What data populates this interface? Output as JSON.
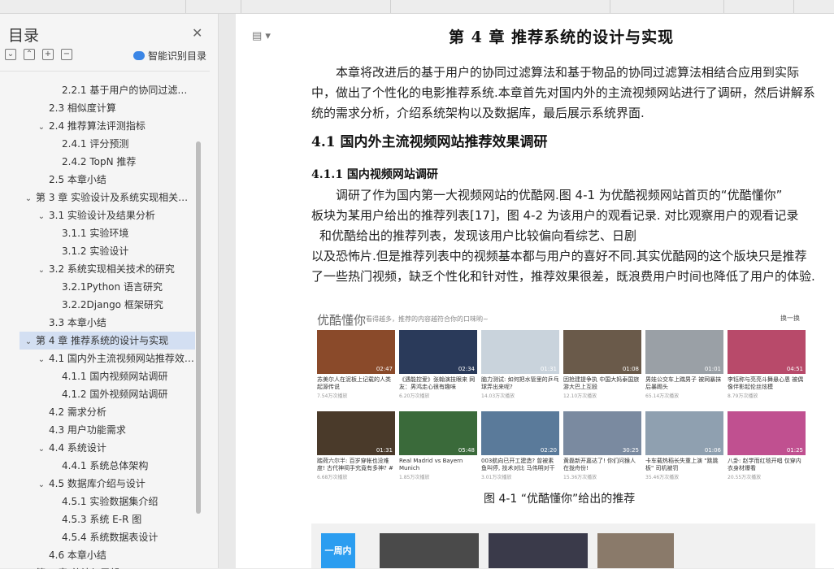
{
  "sidebar": {
    "title": "目录",
    "smart_label": "智能识别目录",
    "items": [
      {
        "label": "2.2.1 基于用户的协同过滤算法",
        "level": 3,
        "arrow": ""
      },
      {
        "label": "2.3 相似度计算",
        "level": 2,
        "arrow": ""
      },
      {
        "label": "2.4 推荐算法评测指标",
        "level": 2,
        "arrow": "⌄"
      },
      {
        "label": "2.4.1 评分预测",
        "level": 3,
        "arrow": ""
      },
      {
        "label": "2.4.2 TopN 推荐",
        "level": 3,
        "arrow": ""
      },
      {
        "label": "2.5 本章小结",
        "level": 2,
        "arrow": ""
      },
      {
        "label": "第 3 章 实验设计及系统实现相关技术",
        "level": 1,
        "arrow": "⌄"
      },
      {
        "label": "3.1 实验设计及结果分析",
        "level": 2,
        "arrow": "⌄"
      },
      {
        "label": "3.1.1 实验环境",
        "level": 3,
        "arrow": ""
      },
      {
        "label": "3.1.2 实验设计",
        "level": 3,
        "arrow": ""
      },
      {
        "label": "3.2 系统实现相关技术的研究",
        "level": 2,
        "arrow": "⌄"
      },
      {
        "label": "3.2.1Python 语言研究",
        "level": 3,
        "arrow": ""
      },
      {
        "label": "3.2.2Django 框架研究",
        "level": 3,
        "arrow": ""
      },
      {
        "label": "3.3 本章小结",
        "level": 2,
        "arrow": ""
      },
      {
        "label": "第 4 章 推荐系统的设计与实现",
        "level": 1,
        "arrow": "⌄",
        "selected": true
      },
      {
        "label": "4.1 国内外主流视频网站推荐效果调研",
        "level": 2,
        "arrow": "⌄"
      },
      {
        "label": "4.1.1 国内视频网站调研",
        "level": 3,
        "arrow": ""
      },
      {
        "label": "4.1.2 国外视频网站调研",
        "level": 3,
        "arrow": ""
      },
      {
        "label": "4.2 需求分析",
        "level": 2,
        "arrow": ""
      },
      {
        "label": "4.3 用户功能需求",
        "level": 2,
        "arrow": ""
      },
      {
        "label": "4.4 系统设计",
        "level": 2,
        "arrow": "⌄"
      },
      {
        "label": "4.4.1 系统总体架构",
        "level": 3,
        "arrow": ""
      },
      {
        "label": "4.5 数据库介绍与设计",
        "level": 2,
        "arrow": "⌄"
      },
      {
        "label": "4.5.1 实验数据集介绍",
        "level": 3,
        "arrow": ""
      },
      {
        "label": "4.5.3 系统 E-R 图",
        "level": 3,
        "arrow": ""
      },
      {
        "label": "4.5.4 系统数据表设计",
        "level": 3,
        "arrow": ""
      },
      {
        "label": "4.6 本章小结",
        "level": 2,
        "arrow": ""
      },
      {
        "label": "第 5 章 总结与展望",
        "level": 1,
        "arrow": "⌄"
      }
    ]
  },
  "doc": {
    "chapter_title": "第 4 章 推荐系统的设计与实现",
    "intro": "本章将改进后的基于用户的协同过滤算法和基于物品的协同过滤算法相结合应用到实际中，做出了个性化的电影推荐系统.本章首先对国内外的主流视频网站进行了调研，然后讲解系统的需求分析，介绍系统架构以及数据库，最后展示系统界面.",
    "h2": "4.1  国内外主流视频网站推荐效果调研",
    "h3": "4.1.1  国内视频网站调研",
    "body_line1": "调研了作为国内第一大视频网站的优酷网.图 4-1 为优酷视频网站首页的“优酷懂你”",
    "body_line2": "板块为某用户给出的推荐列表[17]，图  4-2 为该用户的观看记录. 对比观察用户的观看记录",
    "body_line3": "和优酷给出的推荐列表，发现该用户比较偏向看综艺、日剧",
    "body_rest": "以及恐怖片.但是推荐列表中的视频基本都与用户的喜好不同.其实优酷网的这个版块只是推荐了一些热门视频，缺乏个性化和针对性，推荐效果很差，既浪费用户时间也降低了用户的体验.",
    "caption": "图 4-1  “优酷懂你”给出的推荐"
  },
  "figure": {
    "brand": "优酷懂你",
    "subtitle": "看得越多，推荐的内容越符合你的口味哟~",
    "change": "换一换",
    "videos": [
      {
        "title": "苏美尔人在泥板上记载的人类起源传说",
        "plays": "7.54万次播放",
        "dur": "02:47",
        "color": "#8a4a2a"
      },
      {
        "title": "《遇能控爱》张翰演技眼来 网友：男鸿走心很有趣味",
        "plays": "6.20万次播放",
        "dur": "02:34",
        "color": "#2a3a5a"
      },
      {
        "title": "脑力测试: 如何把水管里的乒乓球弄出来呢?",
        "plays": "14.03万次播放",
        "dur": "01:31",
        "color": "#c9d3dc"
      },
      {
        "title": "因抢建提争执 中国大妈泰国旅游大巴上互殴",
        "plays": "12.10万次播放",
        "dur": "01:08",
        "color": "#6a5a4a"
      },
      {
        "title": "男娃公交车上踹男子 被网暴抹后暴踢头",
        "plays": "65.14万次播放",
        "dur": "01:01",
        "color": "#9aa0a6"
      },
      {
        "title": "李钰称与亮亮斗舞悬心恩 被偶像伴影起伦丝炫模",
        "plays": "8.79万次播放",
        "dur": "04:51",
        "color": "#b84a6a"
      },
      {
        "title": "踏荷六尔半: 百岁穿帐也没难度! 古代神祠手究竟有多神? #",
        "plays": "6.68万次播放",
        "dur": "01:31",
        "color": "#4a3a2a"
      },
      {
        "title": "Real Madrid vs Bayern Munich",
        "plays": "1.85万次播放",
        "dur": "05:48",
        "color": "#3a6a3a"
      },
      {
        "title": "003航向已开工建造? 曾被素鱼叫停, 技术对比 马伟明对干获",
        "plays": "3.01万次播放",
        "dur": "02:20",
        "color": "#5a7a9a"
      },
      {
        "title": "黄磊新开嘉达了! 你们问猴人在拢舟份!",
        "plays": "15.36万次播放",
        "dur": "30:25",
        "color": "#7a8aa0"
      },
      {
        "title": "卡车载热稻长失重上演 \"跳跳板\" 司机被罚",
        "plays": "35.46万次播放",
        "dur": "01:06",
        "color": "#8fa0b0"
      },
      {
        "title": "八卦: 赵学而红毯开唱 仅穿内衣身材爆看",
        "plays": "20.55万次播放",
        "dur": "01:25",
        "color": "#c05090"
      }
    ],
    "week_label": "一周内"
  },
  "colors": {
    "accent": "#3b86e6",
    "selected_row": "#d3dff2"
  }
}
